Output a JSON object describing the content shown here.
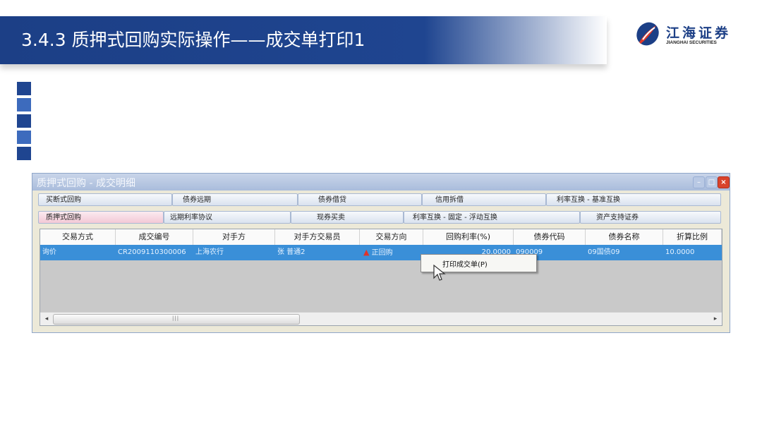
{
  "slide": {
    "title": "3.4.3 质押式回购实际操作——成交单打印1",
    "logo_cn": "江海证券",
    "logo_en": "JIANGHAI SECURITIES",
    "brand_color": "#1f4590"
  },
  "window": {
    "title": "质押式回购 - 成交明细",
    "tabs_row1": [
      "买断式回购",
      "债券远期",
      "债券借贷",
      "信用拆借",
      "利率互换 - 基准互换"
    ],
    "tabs_row2": [
      "质押式回购",
      "远期利率协议",
      "现券买卖",
      "利率互换 - 固定 - 浮动互换",
      "资产支持证券"
    ],
    "active_tab": "质押式回购",
    "columns": [
      "交易方式",
      "成交编号",
      "对手方",
      "对手方交易员",
      "交易方向",
      "回购利率(%)",
      "债券代码",
      "债券名称",
      "折算比例"
    ],
    "row": {
      "mode": "询价",
      "deal_no": "CR2009110300006",
      "counterparty": "上海农行",
      "trader": "张 普通2",
      "direction": "正回购",
      "rate": "20.0000",
      "bond_code": "090009",
      "bond_name": "09国债09",
      "ratio": "10.0000"
    },
    "context_menu": [
      "打印成交单(P)"
    ]
  }
}
